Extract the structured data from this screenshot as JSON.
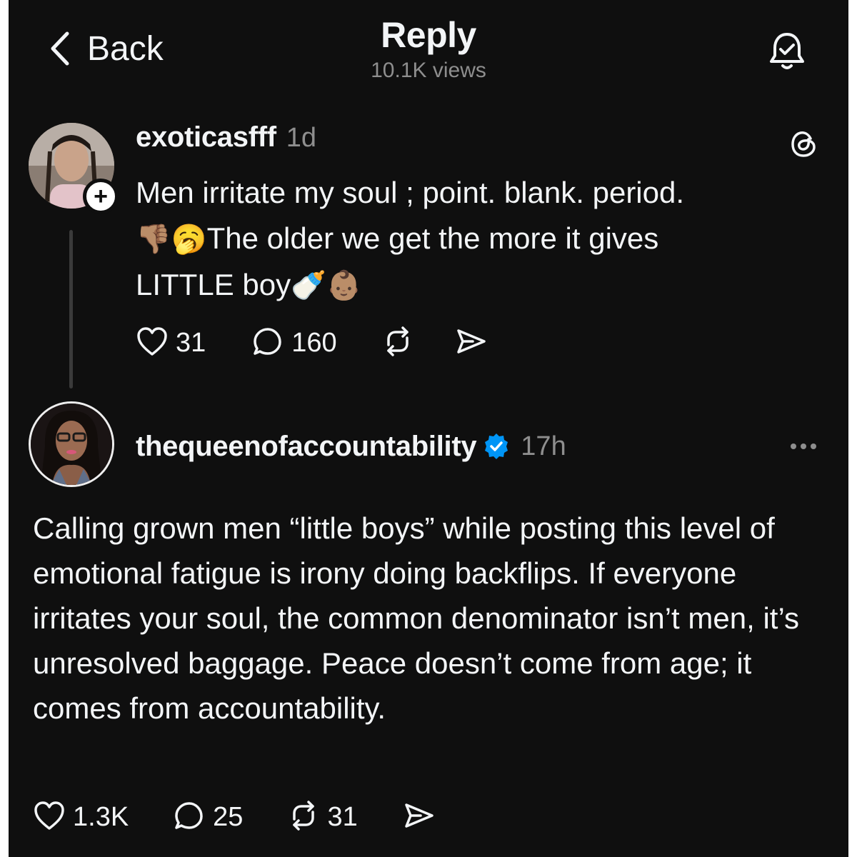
{
  "header": {
    "back_label": "Back",
    "title": "Reply",
    "views": "10.1K views"
  },
  "post": {
    "username": "exoticasfff",
    "time": "1d",
    "line1": "Men irritate my soul ; point. blank. period.",
    "emoji_thumbs_down": "👎🏽",
    "emoji_yawn": "🥱",
    "line2_text": "The older we get the more it gives",
    "line3_text": "LITTLE boy",
    "emoji_bottle": "🍼",
    "emoji_baby": "👶🏽",
    "likes": "31",
    "replies": "160"
  },
  "reply": {
    "username": "thequeenofaccountability",
    "time": "17h",
    "body": "Calling grown men “little boys” while posting this level of emotional fatigue is irony doing backflips. If everyone irritates your soul, the common denominator isn’t men, it’s unresolved baggage. Peace doesn’t come from age; it comes from accountability.",
    "likes": "1.3K",
    "replies": "25",
    "reposts": "31"
  },
  "icons": {
    "back": "chevron-left-icon",
    "bell": "bell-check-icon",
    "threads": "threads-logo-icon",
    "heart": "heart-icon",
    "comment": "comment-icon",
    "repost": "repost-icon",
    "share": "send-icon",
    "verified": "verified-badge-icon",
    "more": "more-dots-icon"
  },
  "colors": {
    "background": "#0f0f0f",
    "text": "#f3f5f7",
    "muted": "#8e8e8e",
    "verified": "#0095f6"
  }
}
